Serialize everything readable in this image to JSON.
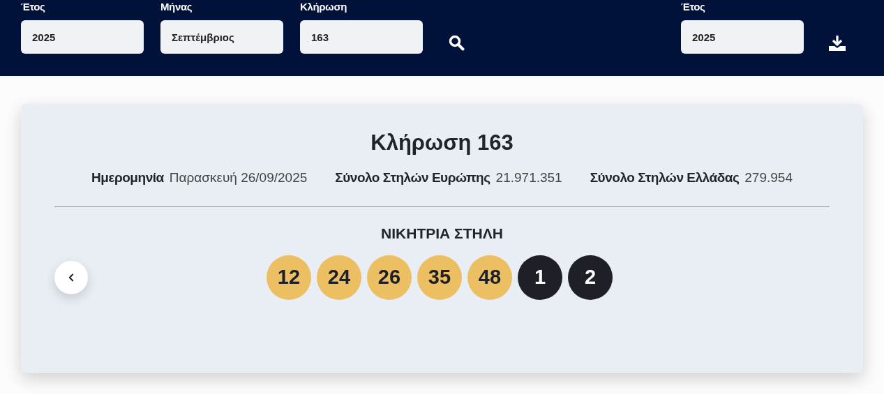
{
  "filters": [
    {
      "label": "Έτος",
      "value": "2025"
    },
    {
      "label": "Μήνας",
      "value": "Σεπτέμβριος"
    },
    {
      "label": "Κλήρωση",
      "value": "163"
    }
  ],
  "export": {
    "label": "Έτος",
    "value": "2025"
  },
  "draw": {
    "title": "Κλήρωση 163",
    "stats": [
      {
        "label": "Ημερομηνία",
        "value": "Παρασκευή 26/09/2025"
      },
      {
        "label": "Σύνολο Στηλών Ευρώπης",
        "value": "21.971.351"
      },
      {
        "label": "Σύνολο Στηλών Ελλάδας",
        "value": "279.954"
      }
    ],
    "winning_title": "ΝΙΚΗΤΡΙΑ ΣΤΗΛΗ",
    "numbers": [
      {
        "kind": "main",
        "value": "12"
      },
      {
        "kind": "main",
        "value": "24"
      },
      {
        "kind": "main",
        "value": "26"
      },
      {
        "kind": "main",
        "value": "35"
      },
      {
        "kind": "main",
        "value": "48"
      },
      {
        "kind": "euro",
        "value": "1"
      },
      {
        "kind": "euro",
        "value": "2"
      }
    ]
  }
}
